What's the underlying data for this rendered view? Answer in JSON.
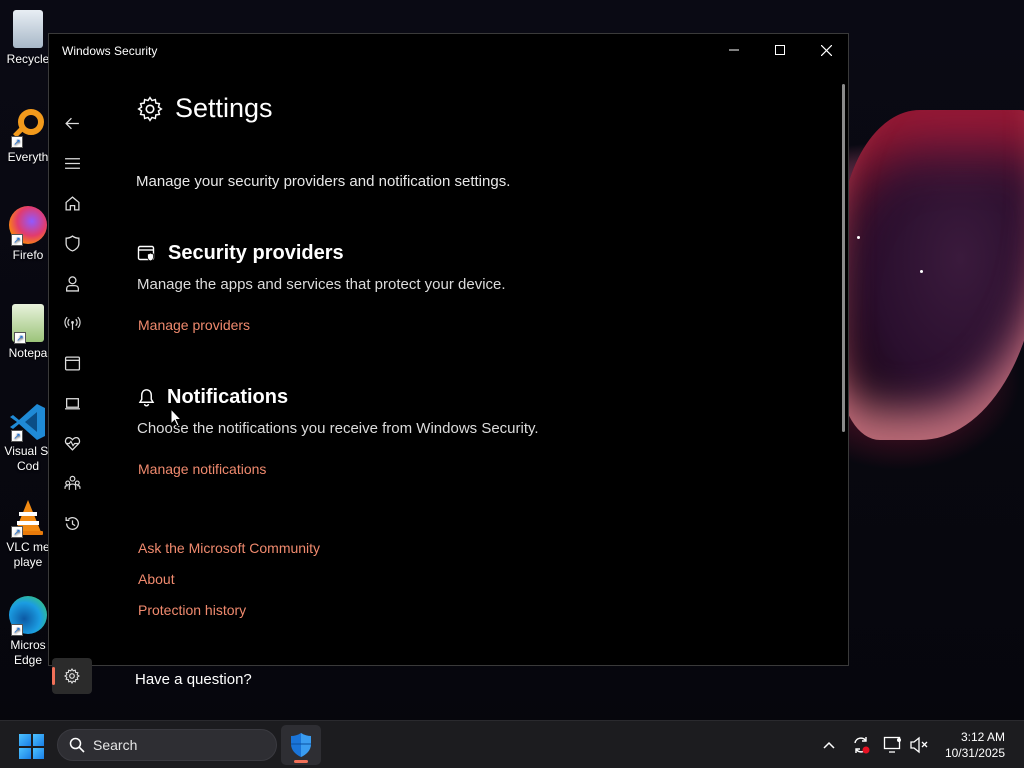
{
  "desktop": {
    "icons": [
      {
        "label": "Recycle",
        "icon": "recycle-bin-icon"
      },
      {
        "label": "Everyth",
        "icon": "everything-search-icon"
      },
      {
        "label": "Firefo",
        "icon": "firefox-icon"
      },
      {
        "label": "Notepa",
        "icon": "notepad-icon"
      },
      {
        "label": "Visual St",
        "label2": "Cod",
        "icon": "vscode-icon"
      },
      {
        "label": "VLC me",
        "label2": "playe",
        "icon": "vlc-icon"
      },
      {
        "label": "Micros",
        "label2": "Edge",
        "icon": "edge-icon"
      }
    ]
  },
  "window": {
    "title": "Windows Security",
    "controls": {
      "minimize": "minimize-icon",
      "maximize": "maximize-icon",
      "close": "close-icon"
    }
  },
  "nav": {
    "items": [
      {
        "name": "back",
        "icon": "back-arrow-icon"
      },
      {
        "name": "menu",
        "icon": "hamburger-menu-icon"
      },
      {
        "name": "home",
        "icon": "home-icon"
      },
      {
        "name": "virus-protection",
        "icon": "shield-icon"
      },
      {
        "name": "account-protection",
        "icon": "person-icon"
      },
      {
        "name": "firewall",
        "icon": "network-antenna-icon"
      },
      {
        "name": "app-browser-control",
        "icon": "browser-window-icon"
      },
      {
        "name": "device-security",
        "icon": "laptop-icon"
      },
      {
        "name": "device-performance",
        "icon": "heart-pulse-icon"
      },
      {
        "name": "family-options",
        "icon": "family-icon"
      },
      {
        "name": "protection-history",
        "icon": "history-icon"
      },
      {
        "name": "settings",
        "icon": "gear-icon",
        "selected": true
      }
    ]
  },
  "page": {
    "title": "Settings",
    "subtitle": "Manage your security providers and notification settings.",
    "sections": {
      "providers": {
        "title": "Security providers",
        "description": "Manage the apps and services that protect your device.",
        "link": "Manage providers"
      },
      "notifications": {
        "title": "Notifications",
        "description": "Choose the notifications you receive from Windows Security.",
        "link": "Manage notifications"
      }
    },
    "links": {
      "community": "Ask the Microsoft Community",
      "about": "About",
      "history": "Protection history"
    },
    "question": "Have a question?"
  },
  "taskbar": {
    "search_placeholder": "Search",
    "time": "3:12 AM",
    "date": "10/31/2025"
  },
  "colors": {
    "accent_link": "#f08a6e",
    "selected_indicator": "#f07058",
    "window_bg": "#000000",
    "taskbar_bg": "#1c1c1f"
  }
}
